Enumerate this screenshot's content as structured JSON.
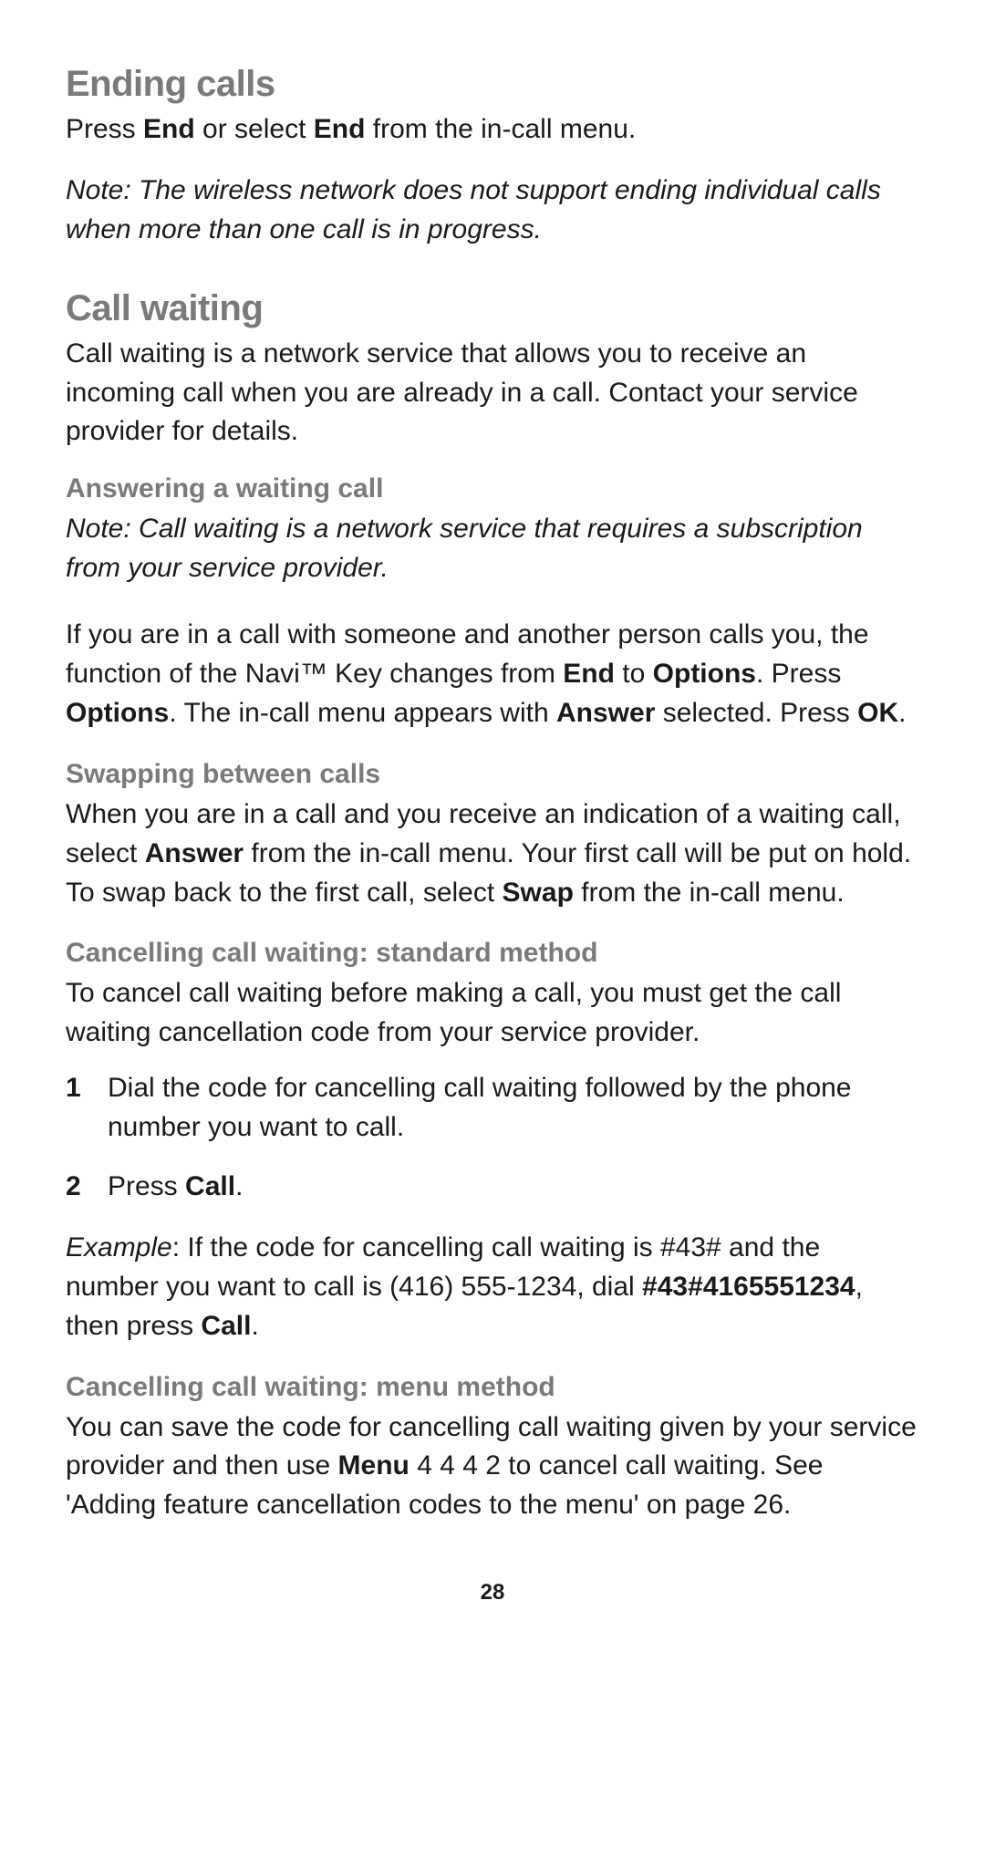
{
  "sections": {
    "ending_calls": {
      "heading": "Ending calls",
      "para1_a": "Press ",
      "para1_b": "End",
      "para1_c": " or select ",
      "para1_d": "End",
      "para1_e": " from the in-call menu.",
      "note": "Note:  The wireless network does not support ending individual calls when more than one call is in progress."
    },
    "call_waiting": {
      "heading": "Call waiting",
      "intro": "Call waiting is a network service that allows you to receive an incoming call when you are already in a call. Contact your service provider for details.",
      "answering": {
        "heading": "Answering a waiting call",
        "note": "Note: Call waiting is a network service that requires a subscription from your service provider.",
        "p_a": "If you are in a call with someone and another person calls you, the function of the Navi™ Key changes from ",
        "p_b": "End",
        "p_c": " to ",
        "p_d": "Options",
        "p_e": ". Press ",
        "p_f": "Options",
        "p_g": ". The in-call menu appears with ",
        "p_h": "Answer",
        "p_i": " selected. Press ",
        "p_j": "OK",
        "p_k": "."
      },
      "swapping": {
        "heading": "Swapping between calls",
        "p_a": "When you are in a call and you receive an indication of a waiting call, select ",
        "p_b": "Answer",
        "p_c": " from the in-call menu. Your first call will be put on hold. To swap back to the first call, select ",
        "p_d": "Swap",
        "p_e": " from the in-call menu."
      },
      "cancel_standard": {
        "heading": "Cancelling call waiting: standard method",
        "intro": "To cancel call waiting before making a call, you must get the call waiting cancellation code from your service provider.",
        "step1_num": "1",
        "step1_txt": "Dial the code for cancelling call waiting followed by the phone number you want to call.",
        "step2_num": "2",
        "step2_a": "Press ",
        "step2_b": "Call",
        "step2_c": ".",
        "example_a_i": "Example",
        "example_b": ":  If the code for cancelling call waiting is #43# and the number you want to call is (416) 555-1234, dial ",
        "example_c": "#43#4165551234",
        "example_d": ", then press ",
        "example_e": "Call",
        "example_f": "."
      },
      "cancel_menu": {
        "heading": "Cancelling call waiting: menu method",
        "p_a": "You can save the code for cancelling call waiting given by your service provider and then use ",
        "p_b": "Menu",
        "p_c": " 4 4 4 2 to cancel call waiting. See 'Adding feature cancellation codes to the menu' on page 26."
      }
    }
  },
  "page_number": "28"
}
